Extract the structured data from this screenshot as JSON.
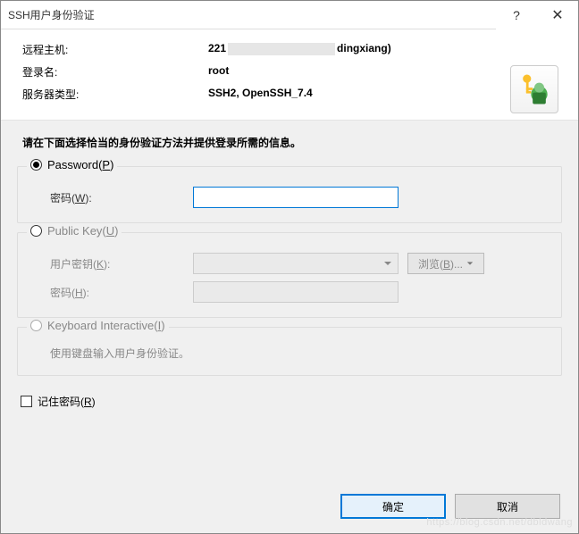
{
  "titlebar": {
    "title": "SSH用户身份验证"
  },
  "header": {
    "labels": {
      "remote_host": "远程主机:",
      "login_name": "登录名:",
      "server_type": "服务器类型:"
    },
    "values": {
      "remote_host_prefix": "221",
      "remote_host_suffix": "dingxiang)",
      "login_name": "root",
      "server_type": "SSH2, OpenSSH_7.4"
    }
  },
  "instruction": "请在下面选择恰当的身份验证方法并提供登录所需的信息。",
  "groups": {
    "password": {
      "legend": "Password(P)",
      "password_label": "密码(W):",
      "password_value": ""
    },
    "publickey": {
      "legend": "Public Key(U)",
      "userkey_label": "用户密钥(K):",
      "password_label": "密码(H):",
      "browse_label": "浏览(B)..."
    },
    "keyboard": {
      "legend": "Keyboard Interactive(I)",
      "desc": "使用键盘输入用户身份验证。"
    }
  },
  "remember_label": "记住密码(R)",
  "buttons": {
    "ok": "确定",
    "cancel": "取消"
  },
  "watermark": "https://blog.csdn.net/dbldwang"
}
